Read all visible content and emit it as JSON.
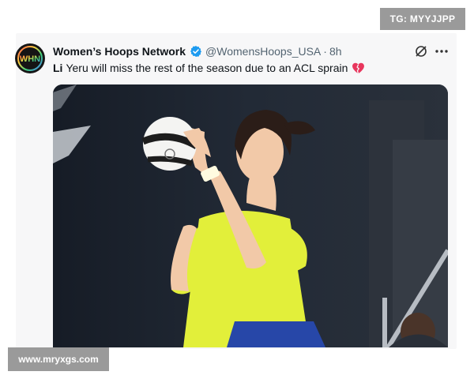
{
  "watermarks": {
    "top_right": "TG: MYYJJPP",
    "bottom_left": "www.mryxgs.com"
  },
  "tweet": {
    "author_name": "Women’s Hoops Network",
    "handle": "@WomensHoops_USA",
    "separator": "·",
    "time": "8h",
    "text_first": "Li",
    "text_rest": "Yeru will miss the rest of the season due to an ACL sprain",
    "avatar_logo_text": "WHN",
    "emoji": "broken-heart-icon",
    "verified_color": "#1d9bf0"
  },
  "colors": {
    "jersey": "#e2ef3a",
    "court_bg": "#1b222d",
    "heart": "#e8365d"
  }
}
